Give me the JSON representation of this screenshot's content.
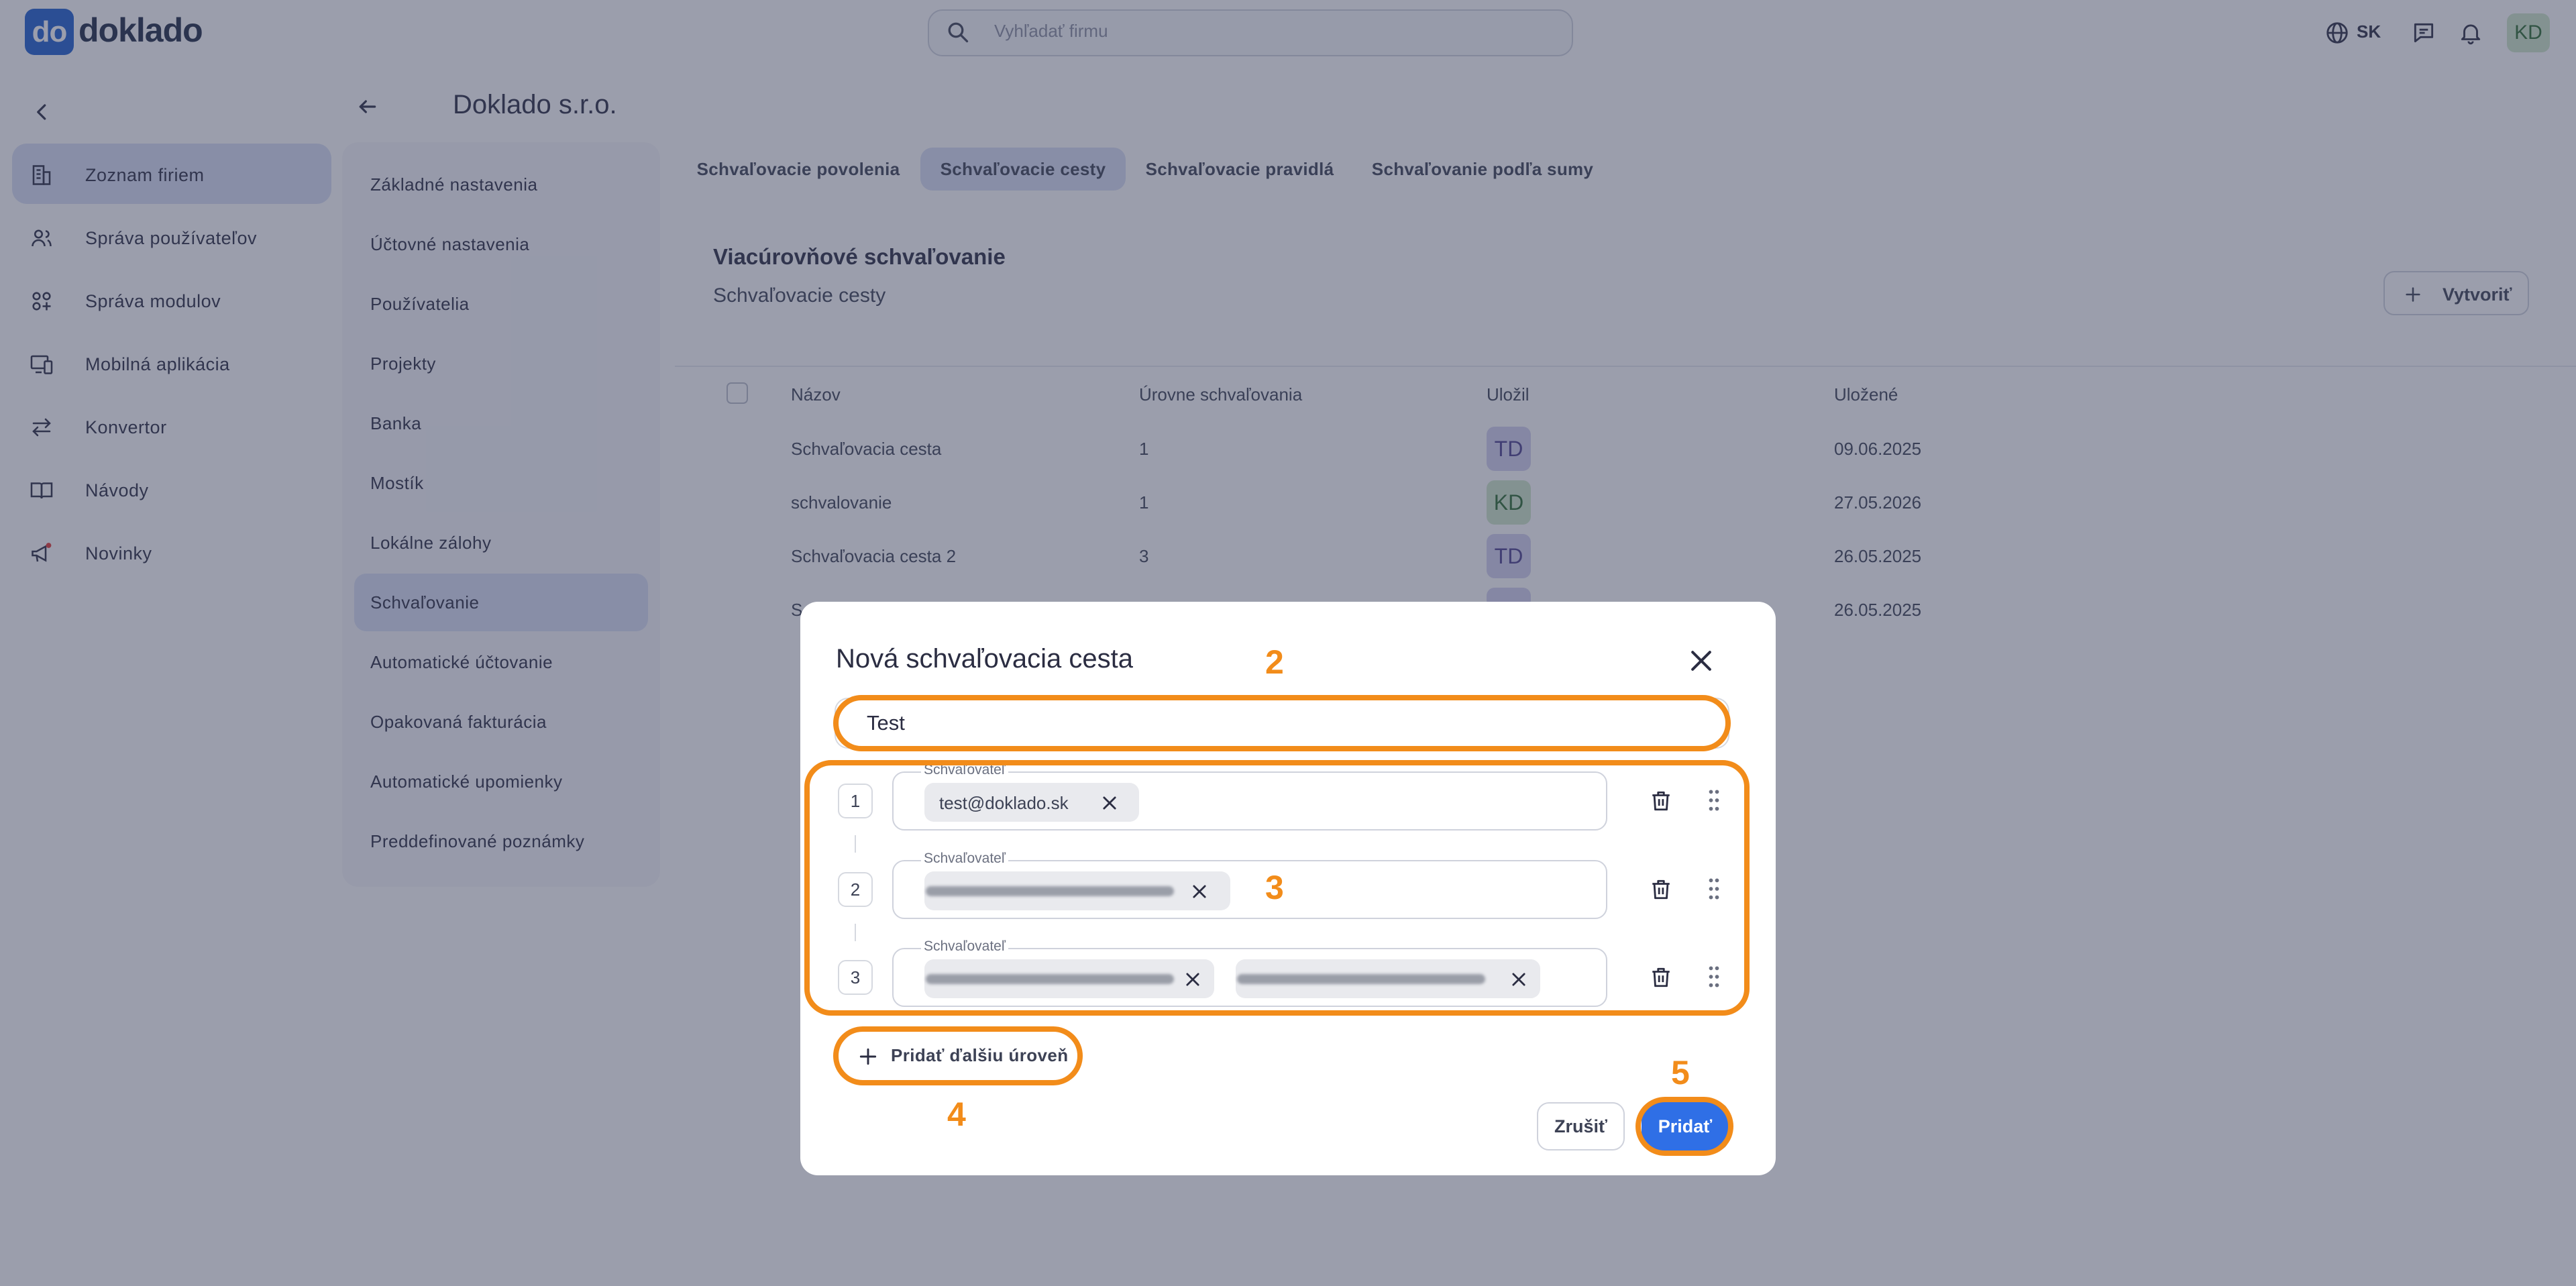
{
  "topbar": {
    "logo_mark": "do",
    "logo_text": "doklado",
    "search_placeholder": "Vyhľadať firmu",
    "language": "SK",
    "user_initials": "KD"
  },
  "sidebar": {
    "items": [
      {
        "label": "Zoznam firiem",
        "icon": "building-icon",
        "active": true
      },
      {
        "label": "Správa používateľov",
        "icon": "users-icon"
      },
      {
        "label": "Správa modulov",
        "icon": "modules-icon"
      },
      {
        "label": "Mobilná aplikácia",
        "icon": "devices-icon"
      },
      {
        "label": "Konvertor",
        "icon": "convert-icon"
      },
      {
        "label": "Návody",
        "icon": "book-icon"
      },
      {
        "label": "Novinky",
        "icon": "megaphone-icon"
      }
    ]
  },
  "company": {
    "title": "Doklado s.r.o."
  },
  "settings_menu": [
    "Základné nastavenia",
    "Účtovné nastavenia",
    "Používatelia",
    "Projekty",
    "Banka",
    "Mostík",
    "Lokálne zálohy",
    "Schvaľovanie",
    "Automatické účtovanie",
    "Opakovaná fakturácia",
    "Automatické upomienky",
    "Preddefinované poznámky"
  ],
  "settings_active": "Schvaľovanie",
  "tabs": [
    "Schvaľovacie povolenia",
    "Schvaľovacie cesty",
    "Schvaľovacie pravidlá",
    "Schvaľovanie podľa sumy"
  ],
  "tabs_active": "Schvaľovacie cesty",
  "card": {
    "title": "Viacúrovňové schvaľovanie",
    "subtitle": "Schvaľovacie cesty",
    "create_label": "Vytvoriť"
  },
  "table": {
    "headers": [
      "Názov",
      "Úrovne schvaľovania",
      "Uložil",
      "Uložené"
    ],
    "rows": [
      {
        "name": "Schvaľovacia cesta",
        "levels": "1",
        "saved_by": "TD",
        "saved_on": "09.06.2025"
      },
      {
        "name": "schvalovanie",
        "levels": "1",
        "saved_by": "KD",
        "saved_on": "27.05.2026"
      },
      {
        "name": "Schvaľovacia cesta 2",
        "levels": "3",
        "saved_by": "TD",
        "saved_on": "26.05.2025"
      },
      {
        "name": "S",
        "levels": "",
        "saved_by": "",
        "saved_on": "26.05.2025"
      }
    ]
  },
  "modal": {
    "title": "Nová schvaľovacia cesta",
    "name_value": "Test",
    "approver_label": "Schvaľovateľ",
    "levels": [
      {
        "number": "1",
        "chips": [
          "test@doklado.sk"
        ]
      },
      {
        "number": "2",
        "chips": [
          "[redacted]"
        ]
      },
      {
        "number": "3",
        "chips": [
          "[redacted]",
          "[redacted]"
        ]
      }
    ],
    "add_level_label": "Pridať ďalšiu úroveň",
    "cancel_label": "Zrušiť",
    "submit_label": "Pridať"
  },
  "annotations": [
    "2",
    "3",
    "4",
    "5"
  ],
  "colors": {
    "brand": "#1e5ecf",
    "primary_button": "#2f6fe6",
    "highlight": "#f28c1a",
    "active_nav": "#d8dff4"
  }
}
